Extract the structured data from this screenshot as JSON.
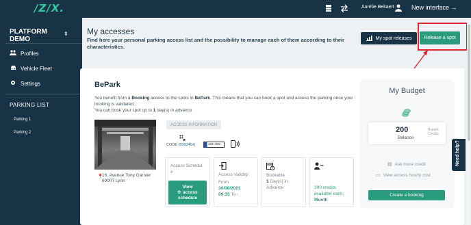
{
  "topbar": {
    "logo": "/Z/X.",
    "user_name": "Aurélie Bekaert",
    "new_interface": "New interface →",
    "icons": [
      "stack-icon",
      "swap-icon",
      "user-icon"
    ]
  },
  "sidebar": {
    "brand_line1": "PLATFORM",
    "brand_line2": "DEMO",
    "items": [
      {
        "label": "Profiles",
        "icon": "users-icon"
      },
      {
        "label": "Vehicle Fleet",
        "icon": "car-icon"
      },
      {
        "label": "Settings",
        "icon": "gear-icon"
      }
    ],
    "parking_list_label": "PARKING LIST",
    "parkings": [
      "Parking 1",
      "Parking 2"
    ]
  },
  "header": {
    "title": "My accesses",
    "subtitle": "Find here your personal parking access list and the possibility to manage each of them according to their characteristics.",
    "my_spot_releases": "My spot releases",
    "release_a_spot": "Release a spot"
  },
  "access": {
    "name": "BePark",
    "desc_part1": "You benefit from a ",
    "desc_bold1": "Booking",
    "desc_part2": " access to the spots in ",
    "desc_bold2": "BePark",
    "desc_part3": ". This means that you can book a spot and access the parking once your booking is validated.",
    "desc_line2_a": "You can book your spot up to ",
    "desc_line2_b": "1",
    "desc_line2_c": " day(s) in advance",
    "address_line1": "16, Avenue Tony Garnier",
    "address_line2": "69007 Lyon",
    "access_info_label": "ACCESS INFORMATION",
    "code_label": "CODE ",
    "code_value": "(939346#)",
    "plate": "123-ABC",
    "schedule_label_1": "Access Schedul",
    "schedule_label_2": "e",
    "view_schedule_1": "View",
    "view_schedule_2": "access",
    "view_schedule_3": "schedule",
    "validity_label": "Access Validity:",
    "validity_from": "From",
    "validity_date": "30/08/2021",
    "validity_time": "09:35",
    "validity_to": " To -",
    "bookable_label": "Bookable",
    "bookable_value": "1",
    "bookable_unit_1": " Day(s) in",
    "bookable_unit_2": "Advance",
    "credits_value": "200",
    "credits_1": " credits",
    "credits_2": "available each:",
    "credits_period": "Month"
  },
  "budget": {
    "title": "My Budget",
    "balance_value": "200",
    "balance_label": "Balance",
    "unit_line1": "Bepark",
    "unit_line2": "Credits",
    "ask_more": "Ask more credit",
    "view_cost": "View access hourly cost",
    "create_booking": "Create a booking"
  },
  "help_tab": "Need help?",
  "colors": {
    "navy": "#173345",
    "accent_green": "#2a9b7c",
    "highlight_red": "#e0262e"
  }
}
